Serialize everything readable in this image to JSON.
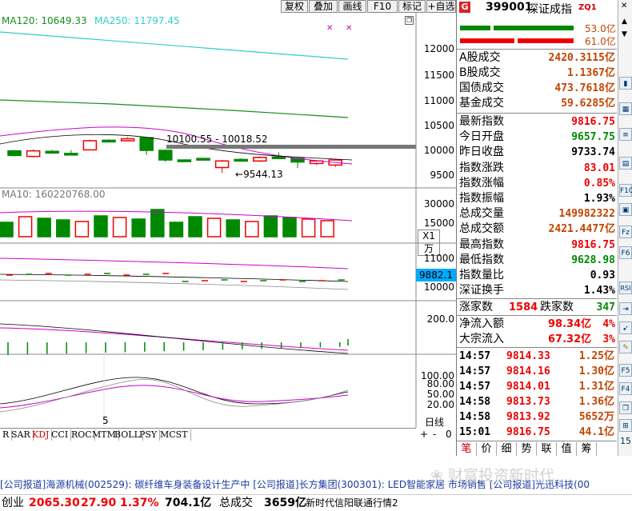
{
  "toolbar": {
    "buttons": [
      "复权",
      "叠加",
      "画线",
      "F10",
      "标记",
      "+自选"
    ],
    "restore_icon": "restore-window-icon"
  },
  "main_chart": {
    "ma120_label": "MA120: 10649.33",
    "ma250_label": "MA250: 11797.45",
    "y_ticks": [
      "12000",
      "11500",
      "11000",
      "10500",
      "10000",
      "9500"
    ],
    "range_annotation": "10100.55 - 10018.52",
    "low_annotation": "9544.13",
    "candles": [
      {
        "o": 9980,
        "c": 9890,
        "h": 10000,
        "l": 9870
      },
      {
        "o": 9870,
        "c": 9980,
        "h": 10010,
        "l": 9860
      },
      {
        "o": 9970,
        "c": 9960,
        "h": 10000,
        "l": 9940
      },
      {
        "o": 9930,
        "c": 9910,
        "h": 10000,
        "l": 9890
      },
      {
        "o": 10000,
        "c": 10180,
        "h": 10200,
        "l": 9990
      },
      {
        "o": 10190,
        "c": 10170,
        "h": 10210,
        "l": 10150
      },
      {
        "o": 10180,
        "c": 10220,
        "h": 10250,
        "l": 10170
      },
      {
        "o": 10240,
        "c": 9990,
        "h": 10260,
        "l": 9900
      },
      {
        "o": 9990,
        "c": 9800,
        "h": 10010,
        "l": 9760
      },
      {
        "o": 9800,
        "c": 9790,
        "h": 9810,
        "l": 9770
      },
      {
        "o": 9830,
        "c": 9810,
        "h": 9840,
        "l": 9790
      },
      {
        "o": 9650,
        "c": 9780,
        "h": 9800,
        "l": 9544
      },
      {
        "o": 9810,
        "c": 9800,
        "h": 9830,
        "l": 9780
      },
      {
        "o": 9780,
        "c": 9850,
        "h": 9870,
        "l": 9760
      },
      {
        "o": 9860,
        "c": 9850,
        "h": 9950,
        "l": 9830
      },
      {
        "o": 9830,
        "c": 9760,
        "h": 9850,
        "l": 9640
      },
      {
        "o": 9730,
        "c": 9780,
        "h": 9800,
        "l": 9700
      },
      {
        "o": 9700,
        "c": 9800,
        "h": 9820,
        "l": 9660
      }
    ]
  },
  "volume_panel": {
    "label": "MA10: 160220768.00",
    "y_ticks": [
      "30000",
      "15000"
    ],
    "unit": "X1万"
  },
  "sub_panel": {
    "y_ticks": [
      "11000",
      "10000"
    ],
    "current_value": "9882.1"
  },
  "macd_panel": {
    "y_ticks": [
      "200.0"
    ]
  },
  "kdj_panel": {
    "y_ticks": [
      "100.00",
      "80.00",
      "50.00",
      "20.00"
    ],
    "date_marker": "5",
    "toolbar": [
      "日线",
      "+",
      "-",
      "0"
    ]
  },
  "indicator_tabs": [
    "R",
    "SAR",
    "KDJ",
    "CCI",
    "ROC",
    "MTM",
    "BOLL",
    "PSY",
    "MCST"
  ],
  "active_tab": "KDJ",
  "quote": {
    "badge": "G",
    "code": "399001",
    "name": "深证成指",
    "suffix": "ZQ1",
    "bar_up_value": "53.0亿",
    "bar_down_value": "61.0亿",
    "turnover": [
      {
        "label": "A股成交",
        "value": "2420.3115亿"
      },
      {
        "label": "B股成交",
        "value": "1.1367亿"
      },
      {
        "label": "国债成交",
        "value": "473.7618亿"
      },
      {
        "label": "基金成交",
        "value": "59.6285亿"
      }
    ],
    "stats": [
      {
        "label": "最新指数",
        "value": "9816.75",
        "color": "red"
      },
      {
        "label": "今日开盘",
        "value": "9657.75",
        "color": "green"
      },
      {
        "label": "昨日收盘",
        "value": "9733.74",
        "color": "dark"
      },
      {
        "label": "指数涨跌",
        "value": "83.01",
        "color": "red"
      },
      {
        "label": "指数涨幅",
        "value": "0.85%",
        "color": "red"
      },
      {
        "label": "指数振幅",
        "value": "1.93%",
        "color": "dark"
      },
      {
        "label": "总成交量",
        "value": "149982322",
        "color": "orange"
      },
      {
        "label": "总成交额",
        "value": "2421.4477亿",
        "color": "orange"
      },
      {
        "label": "最高指数",
        "value": "9816.75",
        "color": "red"
      },
      {
        "label": "最低指数",
        "value": "9628.98",
        "color": "green"
      },
      {
        "label": "指数量比",
        "value": "0.93",
        "color": "dark"
      },
      {
        "label": "深证换手",
        "value": "1.43%",
        "color": "dark"
      }
    ],
    "breadth": {
      "up_label": "涨家数",
      "up": "1584",
      "down_label": "跌家数",
      "down": "347"
    },
    "flows": [
      {
        "label": "净流入额",
        "value": "98.34亿",
        "pct": "4%"
      },
      {
        "label": "大宗流入",
        "value": "67.32亿",
        "pct": "3%"
      }
    ],
    "ticks": [
      {
        "t": "14:57",
        "p": "9814.33",
        "v": "1.25亿"
      },
      {
        "t": "14:57",
        "p": "9814.16",
        "v": "1.30亿"
      },
      {
        "t": "14:57",
        "p": "9814.01",
        "v": "1.31亿"
      },
      {
        "t": "14:58",
        "p": "9813.73",
        "v": "1.36亿"
      },
      {
        "t": "14:58",
        "p": "9813.92",
        "v": "5652万"
      },
      {
        "t": "15:01",
        "p": "9816.75",
        "v": "44.1亿"
      }
    ],
    "bottom_tabs": [
      "笔",
      "价",
      "细",
      "势",
      "联",
      "值",
      "筹"
    ]
  },
  "tool_strip": [
    "F10",
    "F5",
    "Fz",
    "F6",
    "F4",
    "RSI",
    "15"
  ],
  "news": "[公司报道]海源机械(002529): 碳纤维车身装备设计生产中    [公司报道]长方集团(300301): LED智能家居 市场销售    [公司报道]光迅科技(00",
  "watermark": "财富投资新时代",
  "status": {
    "index_name": "创业",
    "index_value": "2065.30",
    "change": "27.90",
    "pct": "1.37%",
    "amount": "704.1亿",
    "total_label": "总成交",
    "total": "3659亿",
    "feed": "新时代信阳联通行情2"
  }
}
